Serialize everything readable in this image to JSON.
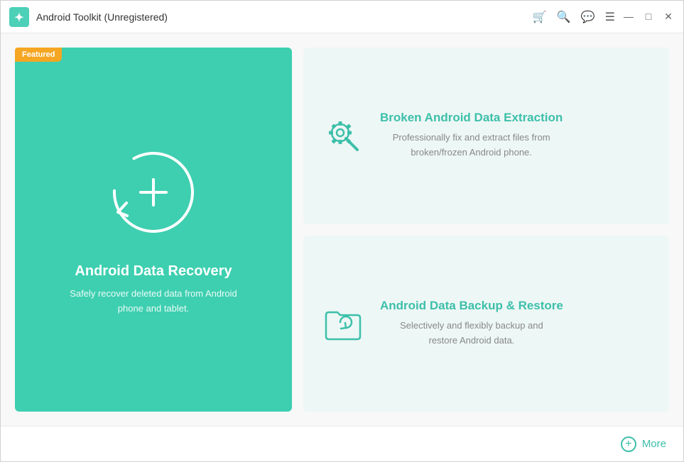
{
  "titleBar": {
    "title": "Android Toolkit (Unregistered)",
    "logoAlt": "app-logo",
    "icons": [
      "cart-icon",
      "search-icon",
      "chat-icon",
      "menu-icon"
    ]
  },
  "windowControls": {
    "minimize": "—",
    "maximize": "□",
    "close": "✕"
  },
  "featuredPanel": {
    "badge": "Featured",
    "title": "Android Data Recovery",
    "description": "Safely recover deleted data from Android\nphone and tablet."
  },
  "cards": [
    {
      "title": "Broken Android Data Extraction",
      "description": "Professionally fix and extract files from\nbroken/frozen Android phone."
    },
    {
      "title": "Android Data Backup & Restore",
      "description": "Selectively and flexibly backup and\nrestore Android data."
    }
  ],
  "bottomBar": {
    "moreLabel": "More"
  }
}
